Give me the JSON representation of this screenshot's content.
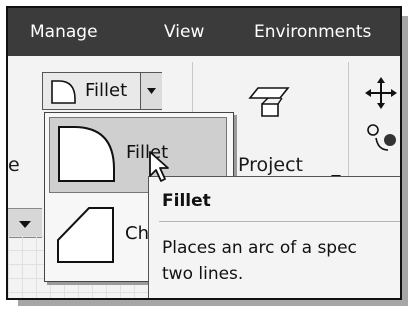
{
  "menubar": {
    "items": [
      {
        "label": "Manage"
      },
      {
        "label": "View"
      },
      {
        "label": "Environments"
      }
    ]
  },
  "ribbon": {
    "left_partial_label": "e",
    "fillet_split": {
      "label": "Fillet"
    },
    "project": {
      "label": "Project"
    },
    "dropdown": {
      "items": [
        {
          "label": "Fillet"
        },
        {
          "label": "Ch"
        }
      ]
    }
  },
  "tooltip": {
    "title": "Fillet",
    "description": "Places an arc of a spec\ntwo lines."
  },
  "colors": {
    "menubar_bg": "#3b3b3b",
    "ribbon_bg": "#f3f3f3",
    "selected_item_bg": "#cfcfcf"
  },
  "icons": [
    "fillet-icon",
    "chamfer-icon",
    "dropdown-arrow-icon",
    "project-icon",
    "move-icon",
    "rotate-icon",
    "cursor-icon"
  ]
}
